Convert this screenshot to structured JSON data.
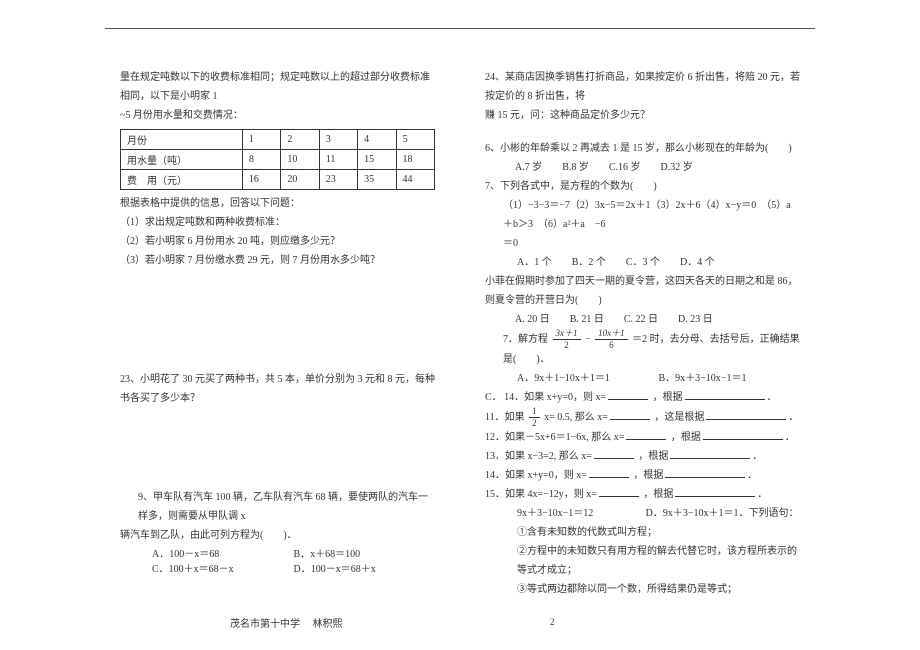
{
  "meta": {
    "footer_school": "茂名市第十中学",
    "footer_teacher": "林积熙",
    "page_num": "2"
  },
  "chart_data": {
    "type": "table",
    "title": "月份用水量与费用",
    "columns": [
      "月份",
      "1",
      "2",
      "3",
      "4",
      "5"
    ],
    "rows": [
      [
        "用水量（吨）",
        "8",
        "10",
        "11",
        "15",
        "18"
      ],
      [
        "费　用（元）",
        "16",
        "20",
        "23",
        "35",
        "44"
      ]
    ]
  },
  "left": {
    "intro1": "量在规定吨数以下的收费标准相同；规定吨数以上的超过部分收费标准相同，以下是小明家 1",
    "intro2": "~5 月份用水量和交费情况：",
    "th_month": "月份",
    "th_1": "1",
    "th_2": "2",
    "th_3": "3",
    "th_4": "4",
    "th_5": "5",
    "r1c0": "用水量（吨）",
    "r1c1": "8",
    "r1c2": "10",
    "r1c3": "11",
    "r1c4": "15",
    "r1c5": "18",
    "r2c0": "费　用（元）",
    "r2c1": "16",
    "r2c2": "20",
    "r2c3": "23",
    "r2c4": "35",
    "r2c5": "44",
    "afterTable": "根据表格中提供的信息，回答以下问题：",
    "q_a": "（1）求出规定吨数和两种收费标准：",
    "q_b": "（2）若小明家 6 月份用水 20 吨，则应缴多少元？",
    "q_c": "（3）若小明家 7 月份缴水费 29 元，则 7 月份用水多少吨？",
    "q23": "23、小明花了 30 元买了两种书，共 5 本，单价分别为 3 元和 8 元，每种书各买了多少本？",
    "q9_a": "9、甲车队有汽车 100 辆，乙车队有汽车 68 辆，要使两队的汽车一样多，则需要从甲队调 x",
    "q9_b": "辆汽车到乙队，由此可列方程为(　　)．",
    "q9_A": "A．100－x＝68",
    "q9_B": "B．x＋68＝100",
    "q9_C": "C．100＋x＝68－x",
    "q9_D": "D．100－x＝68＋x"
  },
  "right": {
    "q24_a": "24、某商店因换季销售打折商品，如果按定价 6 折出售，将赔 20 元，若按定价的 8 折出售，将",
    "q24_b": "赚 15 元，问：这种商品定价多少元？",
    "q6": "6、小彬的年龄乘以 2 再减去 1 是 15 岁，那么小彬现在的年龄为(　　)",
    "q6_opts": "A.7 岁　　B.8 岁　　C.16 岁　　D.32 岁",
    "q7": "7、下列各式中，是方程的个数为(　　)",
    "q7_line": "（1）−3−3＝−7（2）3x−5＝2x＋1（3）2x＋6（4）x−y＝0　（5）a＋b＞3　（6）a²＋a　−6",
    "q7_eq0": "＝0",
    "q7_opts": "A．1 个　　B．2 个　　C．3 个　　D．4 个",
    "qfei": "小菲在假期时参加了四天一期的夏令营，这四天各天的日期之和是 86，则夏令营的开营日为(　　)",
    "qfei_opts": "A. 20 日　　B. 21 日　　C. 22 日　　D. 23 日",
    "q7b_prefix": "7．解方程",
    "q7b_num1": "3x＋1",
    "q7b_den1": "2",
    "q7b_mid": "−",
    "q7b_num2": "10x＋1",
    "q7b_den2": "6",
    "q7b_suffix": "＝2 时，去分母、去括号后，正确结果是(　　)．",
    "q7b_A": "A．9x＋1−10x＋1＝1",
    "q7b_B": "B．9x＋3−10x−1＝1",
    "q7b_C_prefix": "C．",
    "q14": "14．如果 x+y=0，则 x=",
    "q14_mid": "，根据",
    "q14_end": "．",
    "q11_prefix": "11．如果",
    "q11_num": "1",
    "q11_den": "2",
    "q11_mid": "x= 0.5, 那么 x=",
    "q11_mid2": "，这是根据",
    "q12": "12．如果－5x+6＝1−6x, 那么 x=",
    "q12_mid": "，根据",
    "q13": "13．如果 x−3=2, 那么 x=",
    "q13_mid": "，根据",
    "q14b": "14．如果 x+y=0，则 x=",
    "q14b_mid": "，根据",
    "q15": "15．如果 4x=−12y，则 x=",
    "q15_mid": "，根据",
    "line_eq": "9x＋3−10x−1＝12",
    "line_eq_d": "D．9x＋3−10x＋1＝1．下列语句：",
    "s1": "①含有未知数的代数式叫方程；",
    "s2": "②方程中的未知数只有用方程的解去代替它时，该方程所表示的等式才成立；",
    "s3": "③等式两边都除以同一个数，所得结果仍是等式；"
  }
}
